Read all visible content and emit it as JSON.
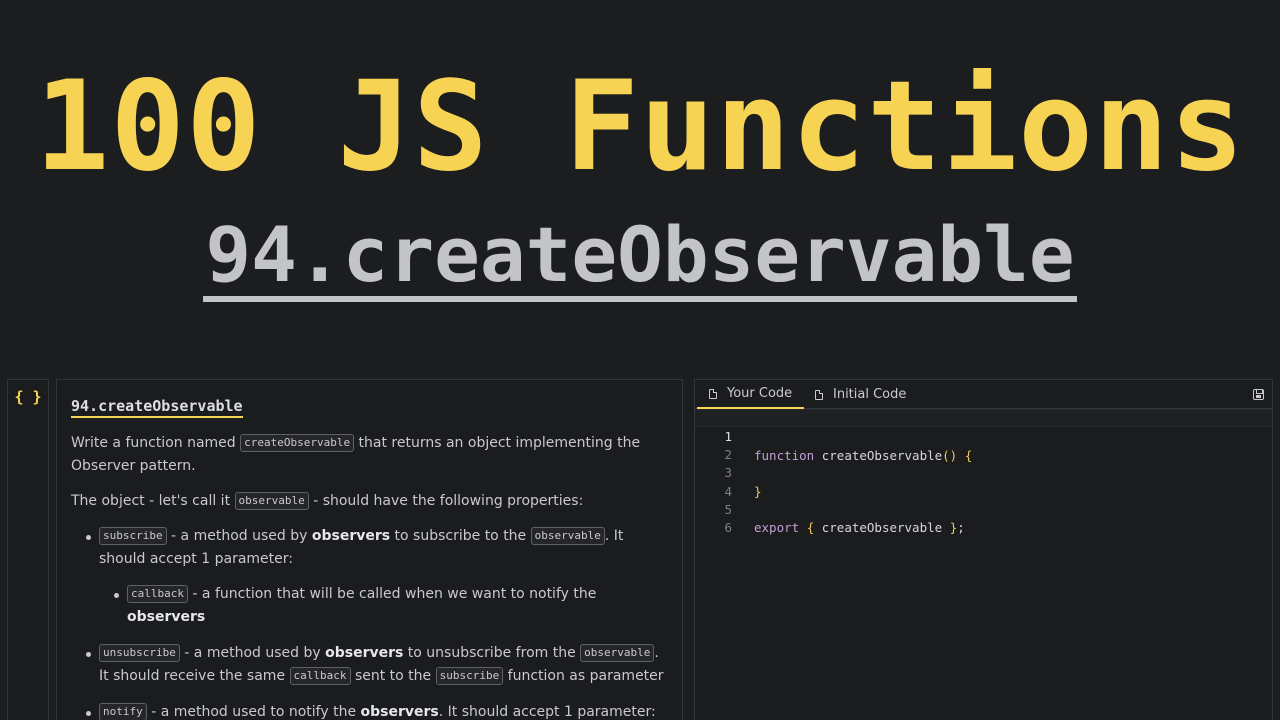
{
  "hero": {
    "title": "100 JS Functions",
    "subtitle": "94.createObservable"
  },
  "rail": {
    "icon": "{ }",
    "icon_name": "braces-icon"
  },
  "description": {
    "title": "94.createObservable",
    "p1_before": "Write a function named ",
    "p1_code": "createObservable",
    "p1_after": " that returns an object implementing the Observer pattern.",
    "p2_before": "The object - let's call it ",
    "p2_code": "observable",
    "p2_after": " - should have the following properties:",
    "items": [
      {
        "code": "subscribe",
        "t1": " - a method used by ",
        "b1": "observers",
        "t2": " to subscribe to the ",
        "code2": "observable",
        "t3": ". It should accept 1 parameter:",
        "sub": {
          "code": "callback",
          "t1": " - a function that will be called when we want to notify the ",
          "b1": "observers"
        }
      },
      {
        "code": "unsubscribe",
        "t1": " - a method used by ",
        "b1": "observers",
        "t2": " to unsubscribe from the ",
        "code2": "observable",
        "t3": ". It should receive the same ",
        "code3": "callback",
        "t4": " sent to the ",
        "code4": "subscribe",
        "t5": " function as parameter"
      },
      {
        "code": "notify",
        "t1": " - a method used to notify the ",
        "b1": "observers",
        "t2": ". It should accept 1 parameter:"
      }
    ]
  },
  "editor": {
    "tabs": [
      {
        "label": "Your Code",
        "active": true
      },
      {
        "label": "Initial Code",
        "active": false
      }
    ],
    "lines": [
      {
        "n": "1",
        "kw": "function",
        "name": " createObservable",
        "paren": "()",
        "rest": " ",
        "brace": "{"
      },
      {
        "n": "2"
      },
      {
        "n": "3",
        "brace": "}"
      },
      {
        "n": "4"
      },
      {
        "n": "5",
        "kw": "export",
        "rest": " ",
        "brace": "{",
        "name": " createObservable ",
        "brace2": "}",
        "tail": ";"
      },
      {
        "n": "6"
      }
    ]
  }
}
